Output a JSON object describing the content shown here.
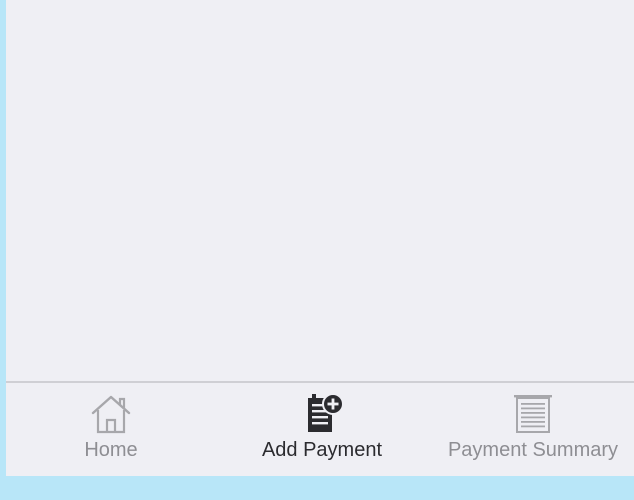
{
  "tabbar": {
    "tabs": [
      {
        "label": "Home",
        "icon": "home-icon",
        "active": false
      },
      {
        "label": "Add Payment",
        "icon": "add-document-icon",
        "active": true
      },
      {
        "label": "Payment Summary",
        "icon": "receipt-icon",
        "active": false
      }
    ]
  },
  "colors": {
    "background": "#efeff4",
    "border": "#b8e6f8",
    "active": "#2b2b2f",
    "inactive": "#8e8e93"
  }
}
